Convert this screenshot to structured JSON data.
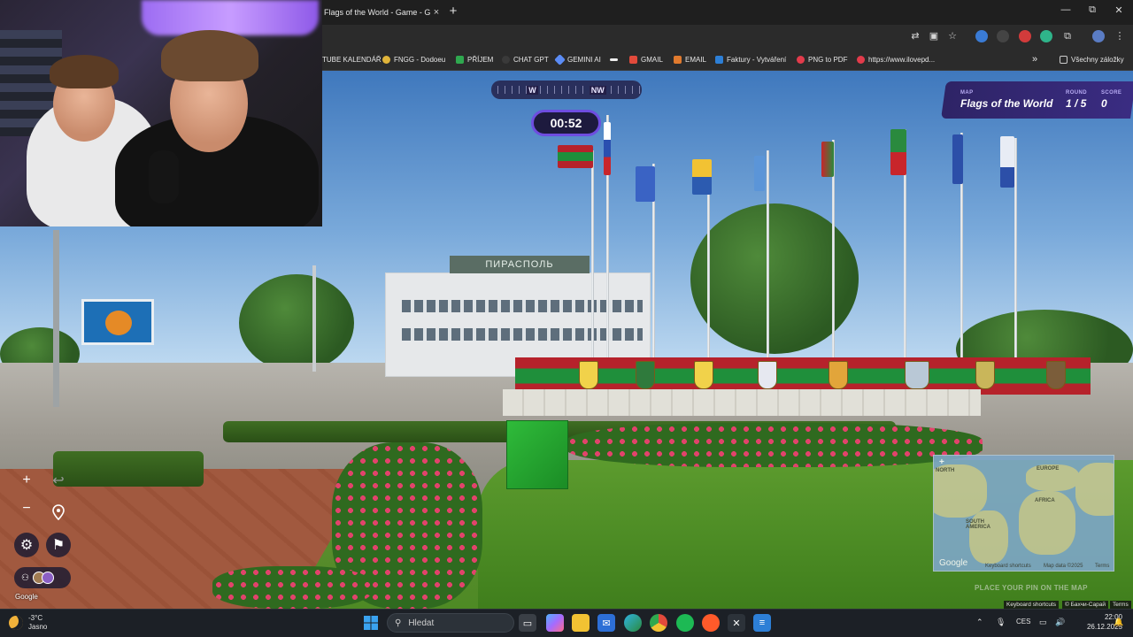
{
  "browser": {
    "tab_title": "Flags of the World - Game - Ge",
    "tab_close": "×",
    "new_tab": "+",
    "window": {
      "minimize": "—",
      "maximize": "⧉",
      "close": "✕"
    },
    "bookmarks": [
      {
        "label": "TUBE KALENDÁŘ",
        "icon_color": "#2b2b2b"
      },
      {
        "label": "FNGG - Dodoeu",
        "icon_color": "#e0b43a"
      },
      {
        "label": "PŘÍJEM",
        "icon_color": "#2fa84f"
      },
      {
        "label": "CHAT GPT",
        "icon_color": "#3a3a3a"
      },
      {
        "label": "GEMINI AI",
        "icon_color": "#5b8cf5"
      },
      {
        "label": "",
        "icon_color": "#111111"
      },
      {
        "label": "GMAIL",
        "icon_color": "#e24a3b"
      },
      {
        "label": "EMAIL",
        "icon_color": "#e07a2e"
      },
      {
        "label": "Faktury - Vytváření",
        "icon_color": "#2d7fd6"
      },
      {
        "label": "PNG to PDF",
        "icon_color": "#e23b4b"
      },
      {
        "label": "https://www.ilovepd...",
        "icon_color": "#e23b4b"
      }
    ],
    "bookmarks_more": "»",
    "all_bookmarks": "Všechny záložky"
  },
  "game": {
    "compass": {
      "left": "W",
      "right": "NW"
    },
    "timer": "00:52",
    "map_label": "MAP",
    "map_name": "Flags of the World",
    "round_label": "ROUND",
    "round_value": "1 / 5",
    "score_label": "SCORE",
    "score_value": "0",
    "zoom_in": "+",
    "zoom_out": "−",
    "undo": "↩",
    "pin_hint": "PLACE YOUR PIN ON THE MAP",
    "google_logo": "Google",
    "building_sign": "ПИРАСПОЛЬ"
  },
  "minimap": {
    "labels": [
      "EUROPE",
      "AFRICA",
      "SOUTH AMERICA",
      "NORTH"
    ],
    "google": "Google",
    "shortcuts": "Keyboard shortcuts",
    "map_data": "Map data ©2025",
    "terms": "Terms",
    "expand": "+"
  },
  "attribution": {
    "shortcuts": "Keyboard shortcuts",
    "copyright": "© Бахчи-Сарай",
    "terms": "Terms"
  },
  "taskbar": {
    "weather_temp": "-3°C",
    "weather_desc": "Jasno",
    "search_placeholder": "Hledat",
    "language": "CES",
    "time": "22:00",
    "date": "26.12.2025"
  },
  "colors": {
    "accent": "#6e4de0",
    "hud_bg": "#2e2466"
  }
}
